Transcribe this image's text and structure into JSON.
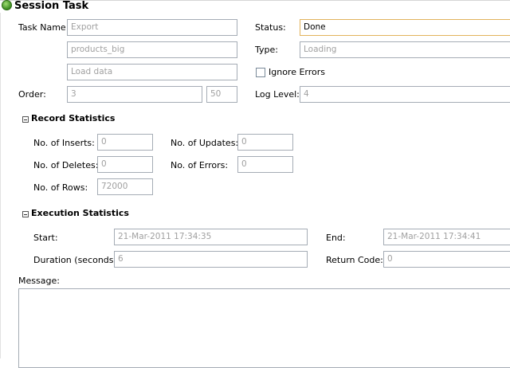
{
  "header": {
    "title": "Session Task",
    "icon": "check-circle-icon"
  },
  "task": {
    "task_name_label": "Task Name:",
    "task_name": "Export",
    "object_name": "products_big",
    "description": "Load data",
    "order_label": "Order:",
    "order_value": "3",
    "order_extra": "50",
    "status_label": "Status:",
    "status_value": "Done",
    "type_label": "Type:",
    "type_value": "Loading",
    "ignore_errors_label": "Ignore Errors",
    "ignore_errors_checked": false,
    "log_level_label": "Log Level:",
    "log_level_value": "4"
  },
  "record_statistics": {
    "heading": "Record Statistics",
    "inserts_label": "No. of Inserts:",
    "inserts_value": "0",
    "updates_label": "No. of Updates:",
    "updates_value": "0",
    "deletes_label": "No. of Deletes:",
    "deletes_value": "0",
    "errors_label": "No. of Errors:",
    "errors_value": "0",
    "rows_label": "No. of Rows:",
    "rows_value": "72000"
  },
  "execution_statistics": {
    "heading": "Execution Statistics",
    "start_label": "Start:",
    "start_value": "21-Mar-2011 17:34:35",
    "end_label": "End:",
    "end_value": "21-Mar-2011 17:34:41",
    "duration_label": "Duration (seconds):",
    "duration_value": "6",
    "return_code_label": "Return Code:",
    "return_code_value": "0"
  },
  "message": {
    "label": "Message:",
    "value": ""
  },
  "colors": {
    "active_border": "#e2b35c",
    "field_border": "#a5acb5",
    "disabled_text": "#a0a0a0"
  }
}
